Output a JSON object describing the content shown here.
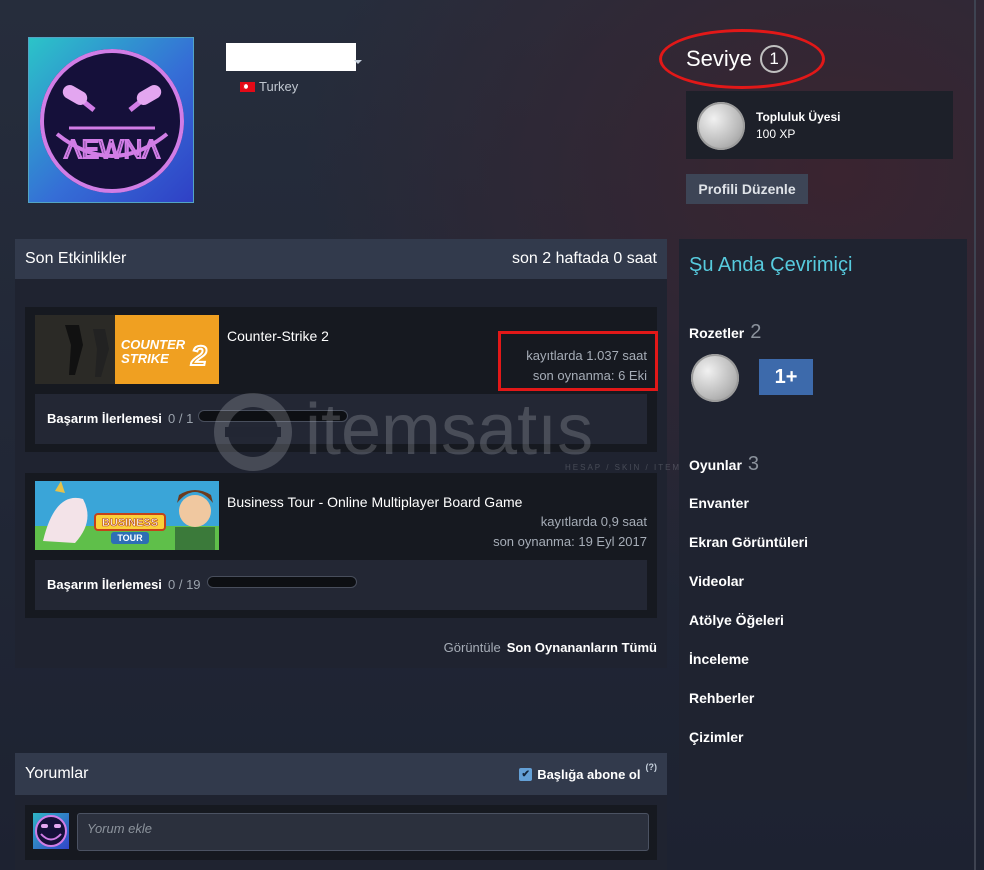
{
  "profile": {
    "country": "Turkey",
    "level_label": "Seviye",
    "level_value": "1",
    "badge_title": "Topluluk Üyesi",
    "badge_xp": "100 XP",
    "edit_profile": "Profili Düzenle"
  },
  "activity": {
    "title": "Son Etkinlikler",
    "summary": "son 2 haftada 0 saat",
    "games": [
      {
        "name": "Counter-Strike 2",
        "hours": "kayıtlarda 1.037 saat",
        "last_played": "son oynanma: 6 Eki",
        "ach_label": "Başarım İlerlemesi",
        "ach_count": "0 / 1"
      },
      {
        "name": "Business Tour - Online Multiplayer Board Game",
        "hours": "kayıtlarda 0,9 saat",
        "last_played": "son oynanma: 19 Eyl 2017",
        "ach_label": "Başarım İlerlemesi",
        "ach_count": "0 / 19"
      }
    ],
    "view_prefix": "Görüntüle",
    "view_all": "Son Oynananların Tümü"
  },
  "cs2_art": {
    "line1": "COUNTER",
    "line2": "STRIKE",
    "num": "2"
  },
  "bt_art": {
    "line1": "BUSINESS",
    "line2": "TOUR"
  },
  "watermark": {
    "brand": "itemsatıs",
    "tagline": "HESAP / SKIN / ITEM"
  },
  "comments": {
    "title": "Yorumlar",
    "subscribe": "Başlığa abone ol",
    "help": "(?)",
    "placeholder": "Yorum ekle"
  },
  "sidebar": {
    "status": "Şu Anda Çevrimiçi",
    "badges_label": "Rozetler",
    "badges_count": "2",
    "years_badge": "1+",
    "games_label": "Oyunlar",
    "games_count": "3",
    "items": [
      "Envanter",
      "Ekran Görüntüleri",
      "Videolar",
      "Atölye Öğeleri",
      "İnceleme",
      "Rehberler",
      "Çizimler"
    ]
  },
  "colors": {
    "accent_online": "#57cbde",
    "highlight_red": "#e21818",
    "panel": "#1f2330",
    "panel_header": "#323a4c"
  }
}
